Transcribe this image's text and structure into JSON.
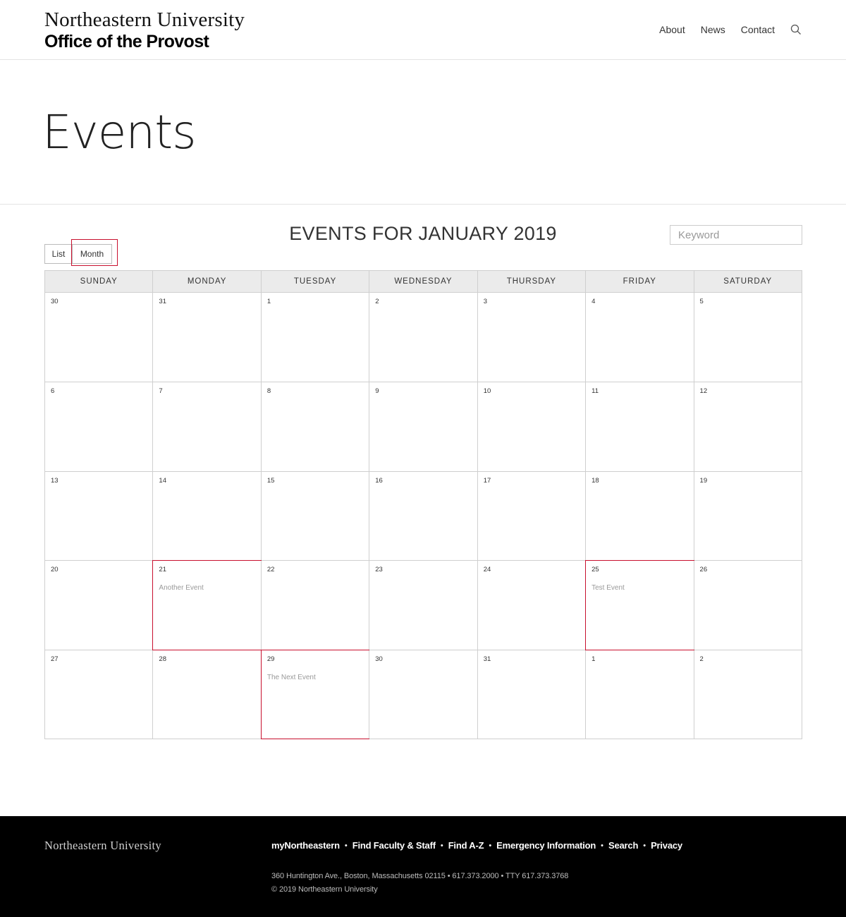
{
  "header": {
    "university": "Northeastern University",
    "office": "Office of the Provost",
    "nav": [
      {
        "label": "About"
      },
      {
        "label": "News"
      },
      {
        "label": "Contact"
      }
    ],
    "search_icon": "search-icon"
  },
  "page": {
    "title": "Events"
  },
  "calendar": {
    "heading": "EVENTS FOR JANUARY 2019",
    "view_list_label": "List",
    "view_month_label": "Month",
    "active_view": "Month",
    "keyword_placeholder": "Keyword",
    "highlight_color": "#c8102e",
    "days": [
      "SUNDAY",
      "MONDAY",
      "TUESDAY",
      "WEDNESDAY",
      "THURSDAY",
      "FRIDAY",
      "SATURDAY"
    ],
    "weeks": [
      [
        {
          "day": "30"
        },
        {
          "day": "31"
        },
        {
          "day": "1"
        },
        {
          "day": "2"
        },
        {
          "day": "3"
        },
        {
          "day": "4"
        },
        {
          "day": "5"
        }
      ],
      [
        {
          "day": "6"
        },
        {
          "day": "7"
        },
        {
          "day": "8"
        },
        {
          "day": "9"
        },
        {
          "day": "10"
        },
        {
          "day": "11"
        },
        {
          "day": "12"
        }
      ],
      [
        {
          "day": "13"
        },
        {
          "day": "14"
        },
        {
          "day": "15"
        },
        {
          "day": "16"
        },
        {
          "day": "17"
        },
        {
          "day": "18"
        },
        {
          "day": "19"
        }
      ],
      [
        {
          "day": "20"
        },
        {
          "day": "21",
          "event": "Another Event"
        },
        {
          "day": "22"
        },
        {
          "day": "23"
        },
        {
          "day": "24"
        },
        {
          "day": "25",
          "event": "Test Event"
        },
        {
          "day": "26"
        }
      ],
      [
        {
          "day": "27"
        },
        {
          "day": "28"
        },
        {
          "day": "29",
          "event": "The Next Event"
        },
        {
          "day": "30"
        },
        {
          "day": "31"
        },
        {
          "day": "1"
        },
        {
          "day": "2"
        }
      ]
    ]
  },
  "footer": {
    "logo": "Northeastern University",
    "links": [
      {
        "label": "myNortheastern"
      },
      {
        "label": "Find Faculty & Staff"
      },
      {
        "label": "Find A-Z"
      },
      {
        "label": "Emergency Information"
      },
      {
        "label": "Search"
      },
      {
        "label": "Privacy"
      }
    ],
    "separator": "•",
    "address": "360 Huntington Ave., Boston, Massachusetts 02115  •  617.373.2000  •  TTY 617.373.3768",
    "copyright": "© 2019 Northeastern University"
  }
}
